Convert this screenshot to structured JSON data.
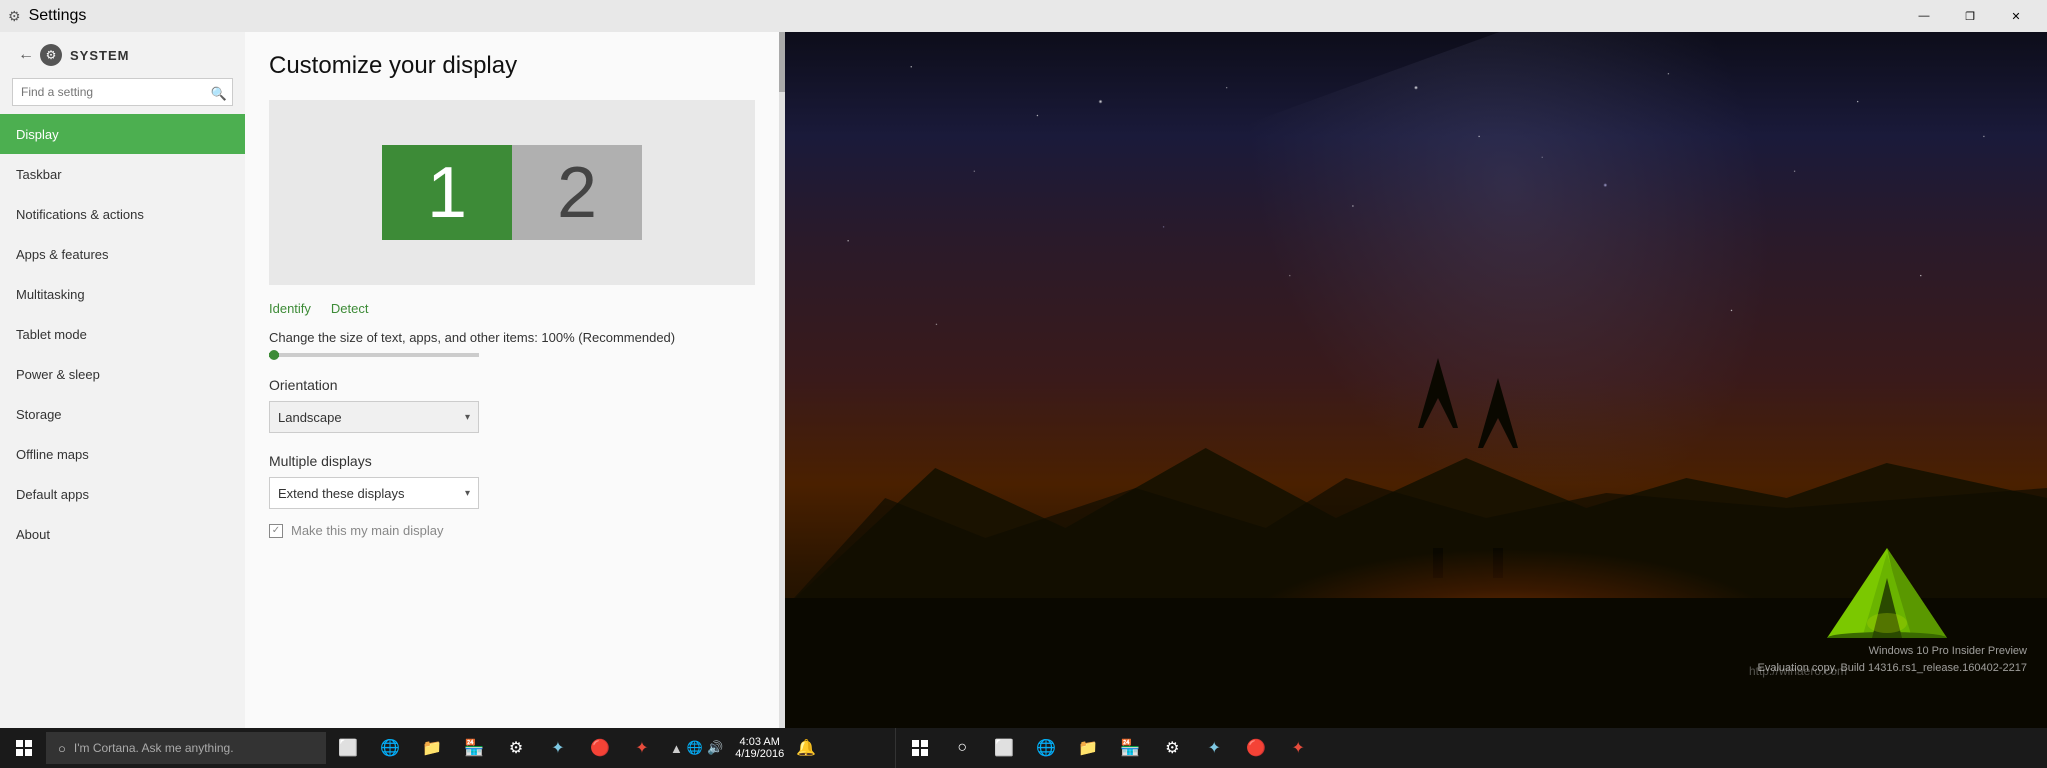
{
  "titlebar": {
    "title": "Settings",
    "minimize_label": "—",
    "maximize_label": "❐",
    "close_label": "✕"
  },
  "sidebar": {
    "system_icon": "⚙",
    "system_title": "SYSTEM",
    "items": [
      {
        "id": "display",
        "label": "Display",
        "active": true
      },
      {
        "id": "taskbar",
        "label": "Taskbar",
        "active": false
      },
      {
        "id": "notifications",
        "label": "Notifications & actions",
        "active": false
      },
      {
        "id": "apps",
        "label": "Apps & features",
        "active": false
      },
      {
        "id": "multitasking",
        "label": "Multitasking",
        "active": false
      },
      {
        "id": "tablet",
        "label": "Tablet mode",
        "active": false
      },
      {
        "id": "power",
        "label": "Power & sleep",
        "active": false
      },
      {
        "id": "storage",
        "label": "Storage",
        "active": false
      },
      {
        "id": "offline",
        "label": "Offline maps",
        "active": false
      },
      {
        "id": "default",
        "label": "Default apps",
        "active": false
      },
      {
        "id": "about",
        "label": "About",
        "active": false
      }
    ]
  },
  "settings": {
    "title": "Customize your display",
    "identify_label": "Identify",
    "detect_label": "Detect",
    "scale_label": "Change the size of text, apps, and other items: 100% (Recommended)",
    "orientation_title": "Orientation",
    "orientation_value": "Landscape",
    "multiple_displays_title": "Multiple displays",
    "multiple_displays_value": "Extend these displays",
    "main_display_label": "Make this my main display",
    "find_setting_placeholder": "Find a setting",
    "display1": "1",
    "display2": "2"
  },
  "taskbar_left": {
    "search_placeholder": "I'm Cortana. Ask me anything.",
    "icons": [
      "⊞",
      "🔔",
      "📁",
      "🌐",
      "⚙",
      "✦",
      "🔴",
      "✦"
    ],
    "clock_time": "4:03 AM",
    "clock_date": "4/19/2016"
  },
  "taskbar_right": {
    "icons": [
      "⊞",
      "○",
      "⬜",
      "🌐",
      "📁",
      "🏪",
      "⚙",
      "✦",
      "🔴",
      "✦"
    ]
  },
  "build_info": {
    "line1": "Windows 10 Pro Insider Preview",
    "line2": "Evaluation copy. Build 14316.rs1_release.160402-2217"
  },
  "watermark": {
    "text": "http://winaero.com"
  }
}
